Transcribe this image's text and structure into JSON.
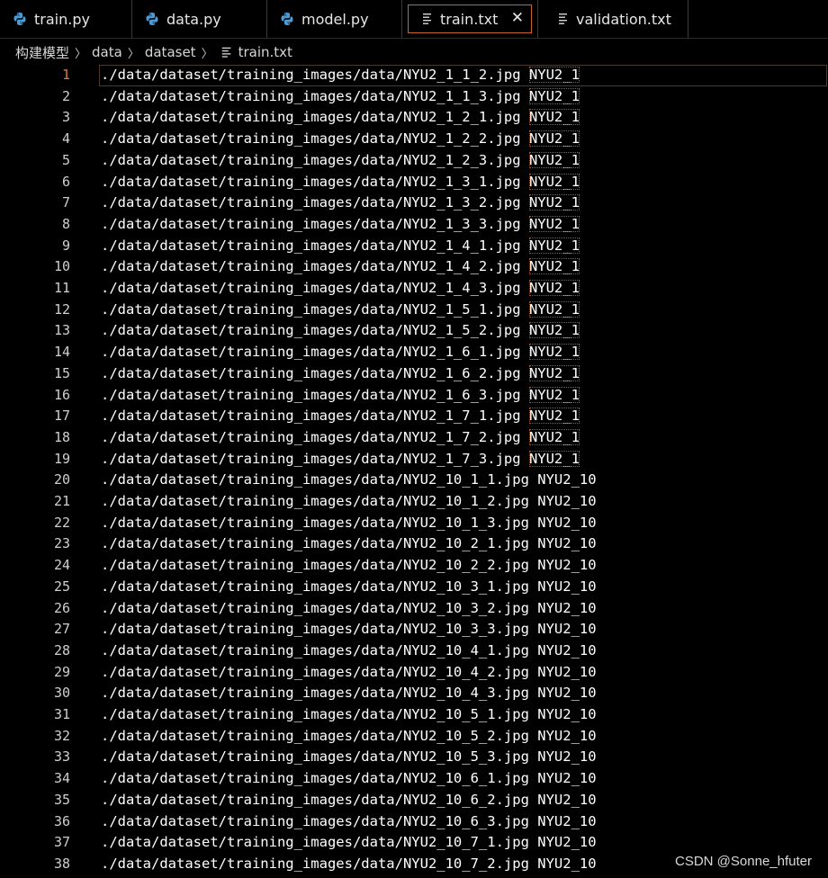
{
  "tabs": [
    {
      "label": "train.py",
      "icon": "python-file-icon"
    },
    {
      "label": "data.py",
      "icon": "python-file-icon"
    },
    {
      "label": "model.py",
      "icon": "python-file-icon"
    },
    {
      "label": "train.txt",
      "icon": "text-file-icon",
      "active": true
    },
    {
      "label": "validation.txt",
      "icon": "text-file-icon"
    }
  ],
  "close_glyph": "✕",
  "breadcrumb": {
    "items": [
      "构建模型",
      "data",
      "dataset",
      "train.txt"
    ],
    "separator": "〉"
  },
  "colors": {
    "accent": "#c9652a",
    "python_icon": "#4d9bd6",
    "current_line_number": "#e0783a"
  },
  "editor": {
    "current_line": 1,
    "lines": [
      {
        "n": "1",
        "path": "./data/dataset/training_images/data/NYU2_1_1_2.jpg",
        "label": "NYU2_1"
      },
      {
        "n": "2",
        "path": "./data/dataset/training_images/data/NYU2_1_1_3.jpg",
        "label": "NYU2_1"
      },
      {
        "n": "3",
        "path": "./data/dataset/training_images/data/NYU2_1_2_1.jpg",
        "label": "NYU2_1"
      },
      {
        "n": "4",
        "path": "./data/dataset/training_images/data/NYU2_1_2_2.jpg",
        "label": "NYU2_1"
      },
      {
        "n": "5",
        "path": "./data/dataset/training_images/data/NYU2_1_2_3.jpg",
        "label": "NYU2_1"
      },
      {
        "n": "6",
        "path": "./data/dataset/training_images/data/NYU2_1_3_1.jpg",
        "label": "NYU2_1"
      },
      {
        "n": "7",
        "path": "./data/dataset/training_images/data/NYU2_1_3_2.jpg",
        "label": "NYU2_1"
      },
      {
        "n": "8",
        "path": "./data/dataset/training_images/data/NYU2_1_3_3.jpg",
        "label": "NYU2_1"
      },
      {
        "n": "9",
        "path": "./data/dataset/training_images/data/NYU2_1_4_1.jpg",
        "label": "NYU2_1"
      },
      {
        "n": "10",
        "path": "./data/dataset/training_images/data/NYU2_1_4_2.jpg",
        "label": "NYU2_1"
      },
      {
        "n": "11",
        "path": "./data/dataset/training_images/data/NYU2_1_4_3.jpg",
        "label": "NYU2_1"
      },
      {
        "n": "12",
        "path": "./data/dataset/training_images/data/NYU2_1_5_1.jpg",
        "label": "NYU2_1"
      },
      {
        "n": "13",
        "path": "./data/dataset/training_images/data/NYU2_1_5_2.jpg",
        "label": "NYU2_1"
      },
      {
        "n": "14",
        "path": "./data/dataset/training_images/data/NYU2_1_6_1.jpg",
        "label": "NYU2_1"
      },
      {
        "n": "15",
        "path": "./data/dataset/training_images/data/NYU2_1_6_2.jpg",
        "label": "NYU2_1"
      },
      {
        "n": "16",
        "path": "./data/dataset/training_images/data/NYU2_1_6_3.jpg",
        "label": "NYU2_1"
      },
      {
        "n": "17",
        "path": "./data/dataset/training_images/data/NYU2_1_7_1.jpg",
        "label": "NYU2_1"
      },
      {
        "n": "18",
        "path": "./data/dataset/training_images/data/NYU2_1_7_2.jpg",
        "label": "NYU2_1"
      },
      {
        "n": "19",
        "path": "./data/dataset/training_images/data/NYU2_1_7_3.jpg",
        "label": "NYU2_1"
      },
      {
        "n": "20",
        "path": "./data/dataset/training_images/data/NYU2_10_1_1.jpg",
        "label": "NYU2_10"
      },
      {
        "n": "21",
        "path": "./data/dataset/training_images/data/NYU2_10_1_2.jpg",
        "label": "NYU2_10"
      },
      {
        "n": "22",
        "path": "./data/dataset/training_images/data/NYU2_10_1_3.jpg",
        "label": "NYU2_10"
      },
      {
        "n": "23",
        "path": "./data/dataset/training_images/data/NYU2_10_2_1.jpg",
        "label": "NYU2_10"
      },
      {
        "n": "24",
        "path": "./data/dataset/training_images/data/NYU2_10_2_2.jpg",
        "label": "NYU2_10"
      },
      {
        "n": "25",
        "path": "./data/dataset/training_images/data/NYU2_10_3_1.jpg",
        "label": "NYU2_10"
      },
      {
        "n": "26",
        "path": "./data/dataset/training_images/data/NYU2_10_3_2.jpg",
        "label": "NYU2_10"
      },
      {
        "n": "27",
        "path": "./data/dataset/training_images/data/NYU2_10_3_3.jpg",
        "label": "NYU2_10"
      },
      {
        "n": "28",
        "path": "./data/dataset/training_images/data/NYU2_10_4_1.jpg",
        "label": "NYU2_10"
      },
      {
        "n": "29",
        "path": "./data/dataset/training_images/data/NYU2_10_4_2.jpg",
        "label": "NYU2_10"
      },
      {
        "n": "30",
        "path": "./data/dataset/training_images/data/NYU2_10_4_3.jpg",
        "label": "NYU2_10"
      },
      {
        "n": "31",
        "path": "./data/dataset/training_images/data/NYU2_10_5_1.jpg",
        "label": "NYU2_10"
      },
      {
        "n": "32",
        "path": "./data/dataset/training_images/data/NYU2_10_5_2.jpg",
        "label": "NYU2_10"
      },
      {
        "n": "33",
        "path": "./data/dataset/training_images/data/NYU2_10_5_3.jpg",
        "label": "NYU2_10"
      },
      {
        "n": "34",
        "path": "./data/dataset/training_images/data/NYU2_10_6_1.jpg",
        "label": "NYU2_10"
      },
      {
        "n": "35",
        "path": "./data/dataset/training_images/data/NYU2_10_6_2.jpg",
        "label": "NYU2_10"
      },
      {
        "n": "36",
        "path": "./data/dataset/training_images/data/NYU2_10_6_3.jpg",
        "label": "NYU2_10"
      },
      {
        "n": "37",
        "path": "./data/dataset/training_images/data/NYU2_10_7_1.jpg",
        "label": "NYU2_10"
      },
      {
        "n": "38",
        "path": "./data/dataset/training_images/data/NYU2_10_7_2.jpg",
        "label": "NYU2_10"
      }
    ]
  },
  "watermark": "CSDN @Sonne_hfuter"
}
